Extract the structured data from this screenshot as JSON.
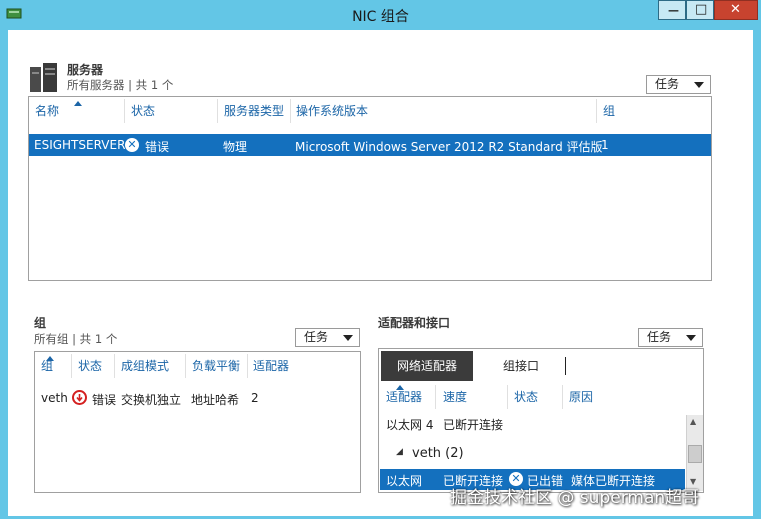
{
  "window": {
    "title": "NIC 组合",
    "min_glyph": "—",
    "max_glyph": "□",
    "close_glyph": "✕"
  },
  "servers": {
    "title": "服务器",
    "subtitle": "所有服务器 | 共 1 个",
    "tasks_label": "任务",
    "columns": [
      "名称",
      "状态",
      "服务器类型",
      "操作系统版本",
      "组"
    ],
    "rows": [
      {
        "name": "ESIGHTSERVER",
        "status": "错误",
        "type": "物理",
        "os": "Microsoft Windows Server 2012 R2 Standard 评估版",
        "group": "1"
      }
    ]
  },
  "teams": {
    "title": "组",
    "subtitle": "所有组 | 共 1 个",
    "tasks_label": "任务",
    "columns": [
      "组",
      "状态",
      "成组模式",
      "负载平衡",
      "适配器"
    ],
    "rows": [
      {
        "team": "veth",
        "status": "错误",
        "mode": "交换机独立",
        "lb": "地址哈希",
        "adapters": "2"
      }
    ]
  },
  "adapters": {
    "title": "适配器和接口",
    "tasks_label": "任务",
    "tabs": [
      "网络适配器",
      "组接口"
    ],
    "columns": [
      "适配器",
      "速度",
      "状态",
      "原因"
    ],
    "rows": [
      {
        "adapter": "以太网 4",
        "speed": "已断开连接",
        "status": "",
        "reason": ""
      }
    ],
    "group_label": "veth (2)",
    "selected_row": {
      "adapter": "以太网",
      "speed": "已断开连接",
      "status": "已出错",
      "reason": "媒体已断开连接"
    }
  },
  "watermark": "掘金技术社区 @ superman超哥",
  "colors": {
    "titlebar": "#63c6e6",
    "selection": "#1470be",
    "header_text": "#1b65a7",
    "error_red": "#d42020",
    "close_button": "#c7432f"
  }
}
